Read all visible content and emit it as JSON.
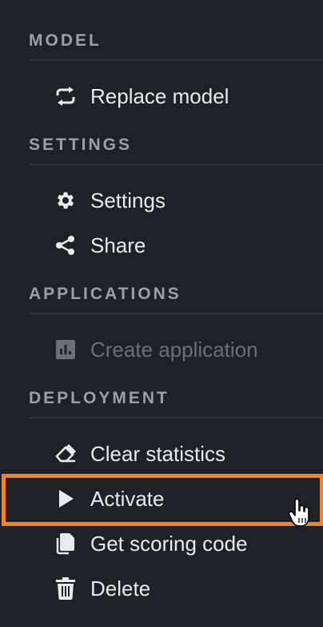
{
  "sections": {
    "model": {
      "header": "MODEL",
      "items": [
        {
          "label": "Replace model",
          "icon": "replace-icon"
        }
      ]
    },
    "settings": {
      "header": "SETTINGS",
      "items": [
        {
          "label": "Settings",
          "icon": "gear-icon"
        },
        {
          "label": "Share",
          "icon": "share-icon"
        }
      ]
    },
    "applications": {
      "header": "APPLICATIONS",
      "items": [
        {
          "label": "Create application",
          "icon": "chart-icon",
          "disabled": true
        }
      ]
    },
    "deployment": {
      "header": "DEPLOYMENT",
      "items": [
        {
          "label": "Clear statistics",
          "icon": "eraser-icon"
        },
        {
          "label": "Activate",
          "icon": "play-icon",
          "highlighted": true
        },
        {
          "label": "Get scoring code",
          "icon": "copy-icon"
        },
        {
          "label": "Delete",
          "icon": "trash-icon"
        }
      ]
    }
  },
  "colors": {
    "background": "#1e2125",
    "text": "#e8eaed",
    "header": "#9aa0a6",
    "disabled": "#6b7075",
    "highlight": "#f58220"
  }
}
